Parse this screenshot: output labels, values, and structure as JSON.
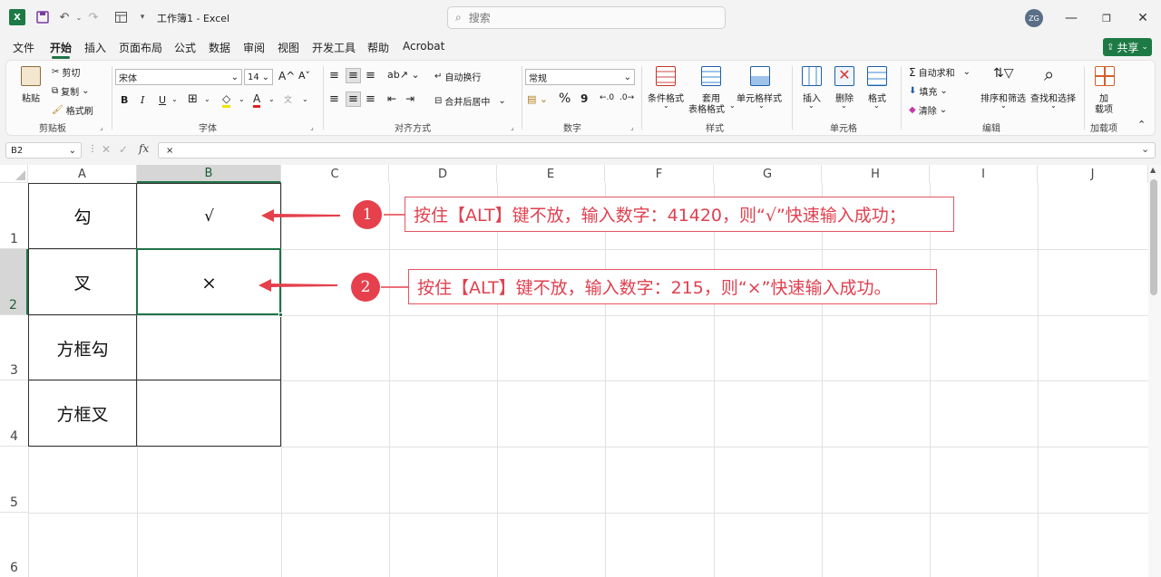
{
  "title_bar": {
    "doc_title": "工作簿1 - Excel",
    "search_placeholder": "搜索",
    "avatar_initials": "ZG"
  },
  "tabs": [
    "文件",
    "开始",
    "插入",
    "页面布局",
    "公式",
    "数据",
    "审阅",
    "视图",
    "开发工具",
    "帮助",
    "Acrobat"
  ],
  "share_label": "共享",
  "ribbon": {
    "clipboard": {
      "paste": "粘贴",
      "cut": "剪切",
      "copy": "复制",
      "format_painter": "格式刷",
      "group": "剪贴板"
    },
    "font": {
      "font_name": "宋体",
      "font_size": "14",
      "bold": "B",
      "italic": "I",
      "underline": "U",
      "grow": "A^",
      "shrink": "A˅",
      "group": "字体"
    },
    "alignment": {
      "wrap": "自动换行",
      "merge": "合并后居中",
      "group": "对齐方式"
    },
    "number": {
      "format": "常规",
      "percent": "%",
      "comma": "9",
      "group": "数字"
    },
    "styles": {
      "conditional": "条件格式",
      "table_line1": "套用",
      "table_line2": "表格格式",
      "cell_styles": "单元格样式",
      "group": "样式"
    },
    "cells": {
      "insert": "插入",
      "delete": "删除",
      "format": "格式",
      "group": "单元格"
    },
    "editing": {
      "autosum": "自动求和",
      "fill": "填充",
      "clear": "清除",
      "sort": "排序和筛选",
      "find": "查找和选择",
      "group": "编辑"
    },
    "addins": {
      "line1": "加",
      "line2": "载项",
      "group": "加载项"
    }
  },
  "formula_bar": {
    "name_box": "B2",
    "fx": "fx",
    "value": "×"
  },
  "columns": [
    "A",
    "B",
    "C",
    "D",
    "E",
    "F",
    "G",
    "H",
    "I",
    "J"
  ],
  "rows": [
    "1",
    "2",
    "3",
    "4",
    "5",
    "6"
  ],
  "cells": {
    "A1": "勾",
    "B1": "√",
    "A2": "叉",
    "B2": "×",
    "A3": "方框勾",
    "A4": "方框叉"
  },
  "annotations": [
    {
      "num": "1",
      "text": "按住【ALT】键不放，输入数字：41420，则“√”快速输入成功；"
    },
    {
      "num": "2",
      "text": "按住【ALT】键不放，输入数字：215，则“×”快速输入成功。"
    }
  ],
  "colors": {
    "accent": "#217346",
    "annotation": "#e5404c"
  }
}
